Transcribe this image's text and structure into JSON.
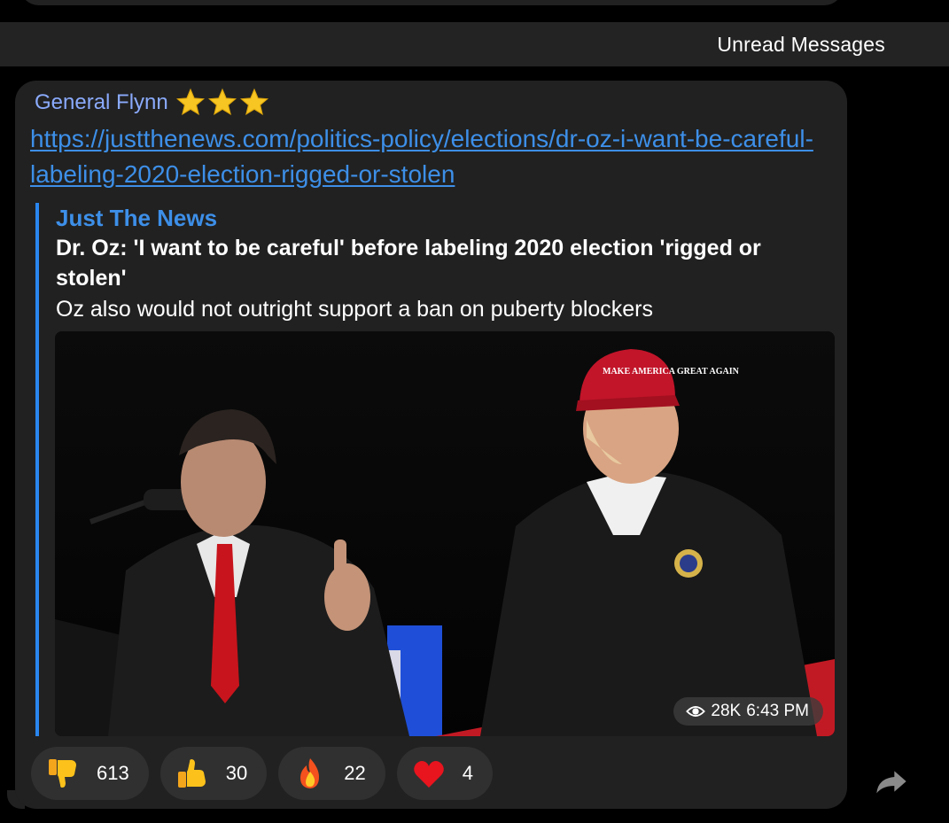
{
  "unread_bar": {
    "label": "Unread Messages"
  },
  "message": {
    "sender": "General Flynn",
    "sender_color": "#8aaafc",
    "badges": [
      "star-icon",
      "star-icon",
      "star-icon"
    ],
    "link_text": "https://justthenews.com/politics-policy/elections/dr-oz-i-want-be-careful-labeling-2020-election-rigged-or-stolen",
    "link_color": "#3d8fe8",
    "preview": {
      "site_name": "Just The News",
      "headline": "Dr. Oz: 'I want to be careful' before labeling 2020 election 'rigged or stolen'",
      "description": "Oz also would not outright support a ban on puberty blockers",
      "image_caption_hat": "MAKE AMERICA GREAT AGAIN"
    },
    "meta": {
      "icon": "eye-icon",
      "views": "28K",
      "time": "6:43 PM"
    },
    "reactions": [
      {
        "emoji": "thumbs-down-icon",
        "count": "613"
      },
      {
        "emoji": "thumbs-up-icon",
        "count": "30"
      },
      {
        "emoji": "fire-icon",
        "count": "22"
      },
      {
        "emoji": "heart-icon",
        "count": "4"
      }
    ]
  },
  "colors": {
    "background": "#000000",
    "bubble": "#212121",
    "reaction_pill": "#303030",
    "accent": "#2a86ef"
  }
}
